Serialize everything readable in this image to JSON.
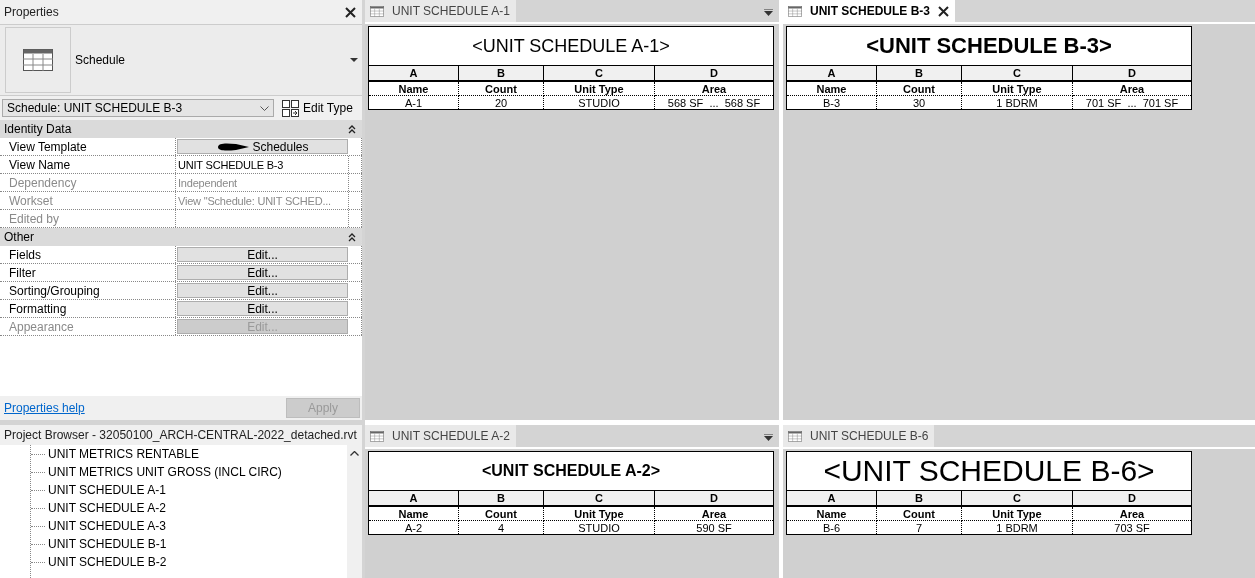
{
  "properties": {
    "title": "Properties",
    "type_name": "Schedule",
    "instance_selector": "Schedule: UNIT SCHEDULE B-3",
    "edit_type": "Edit Type",
    "groups": [
      {
        "name": "Identity Data",
        "expanded": true,
        "rows": [
          {
            "label": "View Template",
            "kind": "button",
            "value": "Schedules",
            "redacted": true,
            "disabled": false
          },
          {
            "label": "View Name",
            "kind": "text",
            "value": "UNIT SCHEDULE B-3",
            "disabled": false
          },
          {
            "label": "Dependency",
            "kind": "text",
            "value": "Independent",
            "disabled": true
          },
          {
            "label": "Workset",
            "kind": "text",
            "value": "View \"Schedule: UNIT SCHED...",
            "disabled": true
          },
          {
            "label": "Edited by",
            "kind": "text",
            "disabled": true
          }
        ]
      },
      {
        "name": "Other",
        "expanded": true,
        "rows": [
          {
            "label": "Fields",
            "kind": "button",
            "value": "Edit...",
            "disabled": false
          },
          {
            "label": "Filter",
            "kind": "button",
            "value": "Edit...",
            "disabled": false
          },
          {
            "label": "Sorting/Grouping",
            "kind": "button",
            "value": "Edit...",
            "disabled": false
          },
          {
            "label": "Formatting",
            "kind": "button",
            "value": "Edit...",
            "disabled": false
          },
          {
            "label": "Appearance",
            "kind": "button",
            "value": "Edit...",
            "disabled": true
          }
        ]
      }
    ],
    "help_link": "Properties help",
    "apply_button": {
      "label": "Apply",
      "disabled": true
    }
  },
  "project_browser": {
    "title": "Project Browser - 32050100_ARCH-CENTRAL-2022_detached.rvt",
    "items": [
      {
        "label": "UNIT METRICS RENTABLE",
        "selected": false
      },
      {
        "label": "UNIT METRICS UNIT GROSS (INCL CIRC)",
        "selected": false
      },
      {
        "label": "UNIT SCHEDULE A-1",
        "selected": false
      },
      {
        "label": "UNIT SCHEDULE A-2",
        "selected": false
      },
      {
        "label": "UNIT SCHEDULE A-3",
        "selected": false
      },
      {
        "label": "UNIT SCHEDULE B-1",
        "selected": false
      },
      {
        "label": "UNIT SCHEDULE B-2",
        "selected": false
      }
    ]
  },
  "views": [
    {
      "tab": "UNIT SCHEDULE A-1",
      "selected": false,
      "menu": true,
      "title": "<UNIT SCHEDULE A-1>",
      "kind": "regular",
      "columns": [
        "A",
        "B",
        "C",
        "D"
      ],
      "headers": [
        "Name",
        "Count",
        "Unit Type",
        "Area"
      ],
      "rows": [
        [
          "A-1",
          "20",
          "STUDIO",
          "568 SF  ...  568 SF"
        ]
      ]
    },
    {
      "tab": "UNIT SCHEDULE B-3",
      "selected": true,
      "menu": false,
      "title": "<UNIT SCHEDULE B-3>",
      "kind": "bold-large",
      "columns": [
        "A",
        "B",
        "C",
        "D"
      ],
      "headers": [
        "Name",
        "Count",
        "Unit Type",
        "Area"
      ],
      "rows": [
        [
          "B-3",
          "30",
          "1 BDRM",
          "701 SF  ...  701 SF"
        ]
      ]
    },
    {
      "tab": "UNIT SCHEDULE A-2",
      "selected": false,
      "menu": true,
      "title": "<UNIT SCHEDULE A-2>",
      "kind": "bold",
      "columns": [
        "A",
        "B",
        "C",
        "D"
      ],
      "headers": [
        "Name",
        "Count",
        "Unit Type",
        "Area"
      ],
      "rows": [
        [
          "A-2",
          "4",
          "STUDIO",
          "590 SF"
        ]
      ]
    },
    {
      "tab": "UNIT SCHEDULE B-6",
      "selected": false,
      "menu": false,
      "title": "<UNIT SCHEDULE B-6>",
      "kind": "huge",
      "columns": [
        "A",
        "B",
        "C",
        "D"
      ],
      "headers": [
        "Name",
        "Count",
        "Unit Type",
        "Area"
      ],
      "rows": [
        [
          "B-6",
          "7",
          "1 BDRM",
          "703 SF"
        ]
      ]
    }
  ]
}
